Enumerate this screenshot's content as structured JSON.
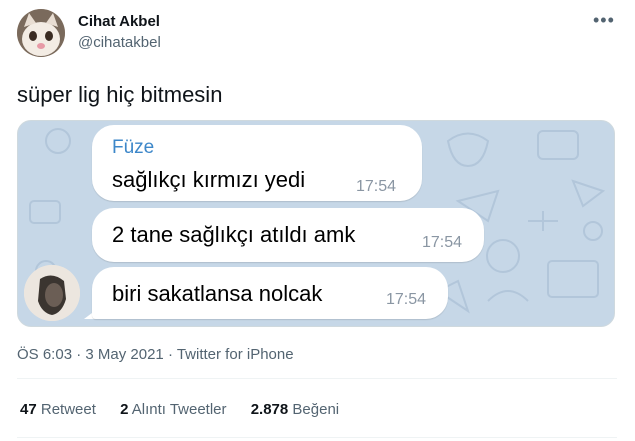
{
  "tweet": {
    "author_name": "Cihat Akbel",
    "author_handle": "@cihatakbel",
    "more_glyph": "•••",
    "text": "süper lig hiç bitmesin",
    "meta": {
      "time": "ÖS 6:03",
      "sep1": " · ",
      "date": "3 May 2021",
      "sep2": " · ",
      "source": "Twitter for iPhone"
    },
    "stats": {
      "retweets_count": "47",
      "retweets_label": "Retweet",
      "quotes_count": "2",
      "quotes_label": "Alıntı Tweetler",
      "likes_count": "2.878",
      "likes_label": "Beğeni"
    }
  },
  "chat": {
    "sender": "Füze",
    "messages": [
      {
        "text": "sağlıkçı kırmızı yedi",
        "time": "17:54"
      },
      {
        "text": "2 tane sağlıkçı atıldı amk",
        "time": "17:54"
      },
      {
        "text": "biri sakatlansa nolcak",
        "time": "17:54"
      }
    ]
  },
  "colors": {
    "chat_background": "#c6d7e7",
    "sender_name": "#3d87c9",
    "secondary_text": "#536471"
  }
}
